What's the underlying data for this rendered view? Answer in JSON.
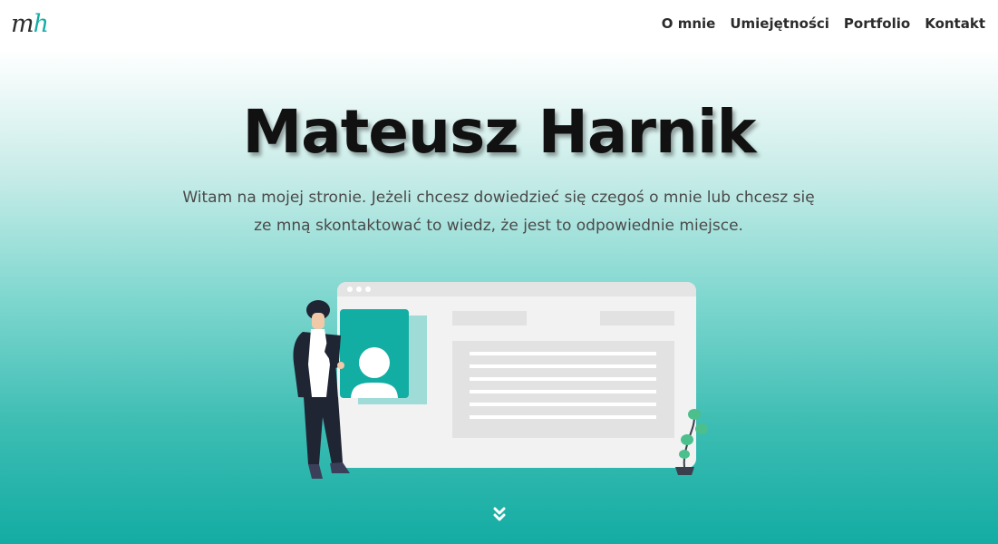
{
  "header": {
    "logo": {
      "m": "m",
      "h": "h"
    },
    "nav": [
      {
        "label": "O mnie"
      },
      {
        "label": "Umiejętności"
      },
      {
        "label": "Portfolio"
      },
      {
        "label": "Kontakt"
      }
    ]
  },
  "hero": {
    "title": "Mateusz Harnik",
    "description": "Witam na mojej stronie. Jeżeli chcesz dowiedzieć się czegoś o mnie lub chcesz się ze mną skontaktować to wiedz, że jest to odpowiednie miejsce."
  },
  "colors": {
    "accent": "#12aea4",
    "text_dark": "#111111",
    "nav_text": "#2b2b2b"
  },
  "icons": {
    "scroll": "double-chevron-down-icon"
  }
}
